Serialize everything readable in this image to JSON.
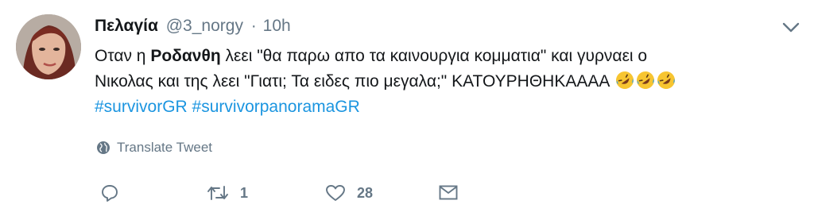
{
  "tweet": {
    "author_name": "Πελαγία",
    "handle": "@3_norgy",
    "separator": "·",
    "time": "10h",
    "text": {
      "l1_a": "Οταν η ",
      "l1_bold": "Ροδανθη",
      "l1_b": " λεει \"θα παρω απο τα καινουργια κομματια\" και γυρναει ο",
      "l2": "Νικολας και της λεει \"Γιατι; Τα ειδες πιο μεγαλα;\" ΚΑΤΟΥΡΗΘΗΚΑΑΑΑ",
      "emoji": "rolling-on-floor-laughing"
    },
    "hashtags": [
      "#survivorGR",
      "#survivorpanoramaGR"
    ],
    "translate_label": "Translate Tweet",
    "actions": {
      "reply_count": "",
      "retweet_count": "1",
      "like_count": "28"
    }
  },
  "colors": {
    "text": "#14171a",
    "muted": "#657786",
    "link": "#1b95e0",
    "emoji_face": "#f7c531",
    "emoji_tear": "#3ea2e0"
  },
  "icons": [
    "caret-down-icon",
    "globe-icon",
    "reply-icon",
    "retweet-icon",
    "heart-icon",
    "direct-message-icon"
  ]
}
